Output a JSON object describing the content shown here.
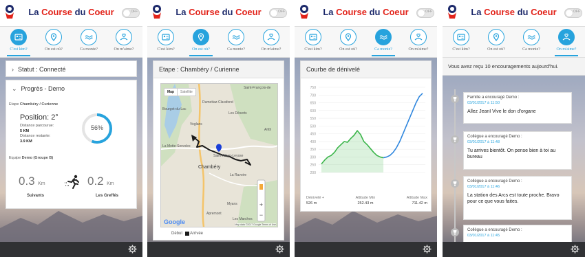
{
  "app": {
    "title_black": "La ",
    "title_red": "Course",
    "title_black2": " du ",
    "title_red2": "Coeur",
    "toggle_label": "OFF"
  },
  "nav": [
    "C'est kim?",
    "On est où?",
    "Ca monte?",
    "On m'aime?"
  ],
  "panel1": {
    "status": "Statut : Connecté",
    "progress_title": "Progrès - Demo",
    "etape_label": "Etape",
    "etape_value": "Chambéry / Curienne",
    "position": "Position: 2°",
    "dist_done_label": "Distance parcourue:",
    "dist_done": "5 KM",
    "dist_left_label": "Distance restante:",
    "dist_left": "3.9 KM",
    "percent": "56%",
    "percent_value": 0.56,
    "team_label": "Equipe",
    "team_value": "Demo (Groupe B)",
    "left_value": "0.3",
    "left_unit": "Km",
    "left_label": "Suivants",
    "right_value": "0.2",
    "right_unit": "Km",
    "right_label": "Les Greffés"
  },
  "panel2": {
    "etape": "Etape : Chambéry / Curienne",
    "map_tab": "Map",
    "sat_tab": "Satellite",
    "places": [
      "Saint-François-de",
      "Dumettaz-Clarafond",
      "Bourget-du-Lac",
      "Les Déserts",
      "Voglans",
      "Arith",
      "La Motte-Servolex",
      "Saint-Alban-Leysse",
      "Chambéry",
      "La Ravoire",
      "Apremont",
      "Myans",
      "Les Marches"
    ],
    "google": "Google",
    "map_credit": "Map data ©2017 Google   Terms of Use",
    "legend_start": "Début",
    "legend_end": "Arrivée"
  },
  "panel3": {
    "title": "Courbe de dénivelé",
    "ylabels": [
      "750",
      "700",
      "650",
      "600",
      "550",
      "500",
      "450",
      "400",
      "350",
      "300",
      "250",
      "200"
    ],
    "stats": [
      {
        "label": "Dénivelé +",
        "value": "526 m"
      },
      {
        "label": "Altitude Min",
        "value": "252.43 m"
      },
      {
        "label": "Altitude Max",
        "value": "711.42 m"
      }
    ]
  },
  "chart_data": {
    "type": "area",
    "title": "Courbe de dénivelé",
    "ylim": [
      200,
      750
    ],
    "series": [
      {
        "color": "#3bb54a",
        "values": [
          255,
          280,
          300,
          310,
          330,
          360,
          380,
          400,
          395,
          420,
          440,
          470,
          445,
          400,
          380,
          355,
          330,
          310,
          300,
          295
        ]
      },
      {
        "color": "#2e86de",
        "values": [
          295,
          300,
          310,
          330,
          360,
          400,
          450,
          500,
          550,
          600,
          650,
          690,
          711
        ]
      }
    ]
  },
  "panel4": {
    "header": "Vous avez reçu 10 encouragements aujourd'hui.",
    "messages": [
      {
        "who": "Famille a encouragé Demo :",
        "when": "03/01/2017 à 11:50",
        "text": "Allez JeanI Vive le don d'organe"
      },
      {
        "who": "Collègue a encouragé Demo :",
        "when": "03/01/2017 à 11:48",
        "text": "Tu arrives bientôt. On pense bien à toi au bureau"
      },
      {
        "who": "Collègue a encouragé Demo :",
        "when": "03/01/2017 à 11:46",
        "text": "La station des Arcs est toute proche. Bravo pour ce que vous faites."
      },
      {
        "who": "Collègue a encouragé Demo :",
        "when": "03/01/2017 à 11:45",
        "text": ""
      }
    ]
  },
  "colors": {
    "accent": "#27a3dd",
    "brand_red": "#e2231a",
    "brand_navy": "#1d2a6b",
    "route": "#1a1a1a",
    "marker": "#1a3fd8",
    "green": "#3bb54a",
    "blue": "#2e86de"
  },
  "icons": [
    "logo-icon",
    "id-card-icon",
    "map-pin-icon",
    "wave-icon",
    "heart-hand-icon",
    "gear-icon",
    "trophy-icon",
    "runner-icon",
    "chevron-right-icon",
    "chevron-down-icon"
  ]
}
